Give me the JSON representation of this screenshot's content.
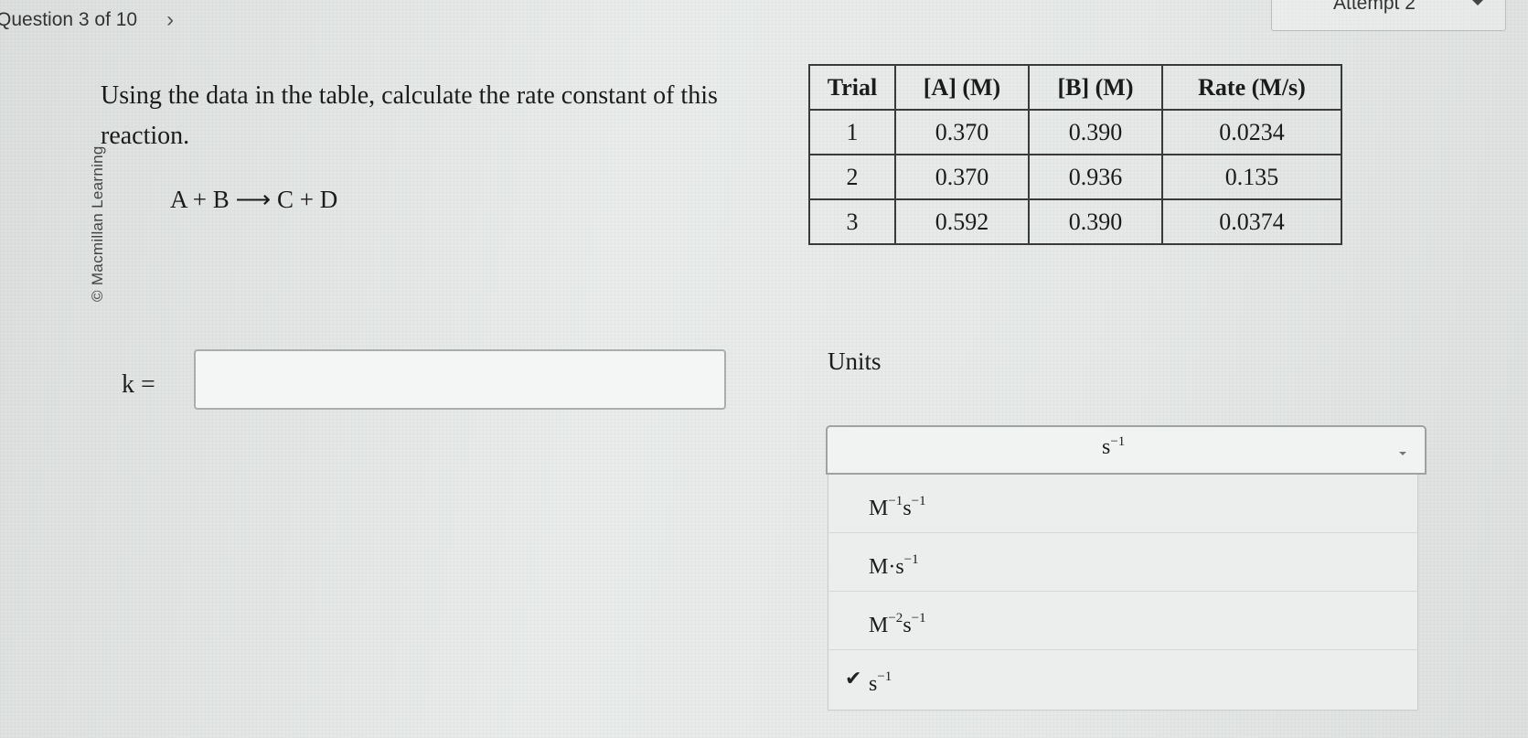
{
  "header": {
    "question_progress": "Question 3 of 10",
    "next_chevron": "›",
    "attempt_label": "Attempt 2"
  },
  "copyright": "© Macmillan Learning",
  "question": {
    "prompt": "Using the data in the table, calculate the rate constant of this reaction.",
    "reaction": "A + B ⟶ C + D"
  },
  "table": {
    "headers": [
      "Trial",
      "[A] (M)",
      "[B] (M)",
      "Rate (M/s)"
    ],
    "rows": [
      [
        "1",
        "0.370",
        "0.390",
        "0.0234"
      ],
      [
        "2",
        "0.370",
        "0.936",
        "0.135"
      ],
      [
        "3",
        "0.592",
        "0.390",
        "0.0374"
      ]
    ]
  },
  "answer": {
    "k_label": "k =",
    "k_value": "",
    "units_label": "Units",
    "units_selected": {
      "base": "s",
      "exp": "−1"
    },
    "units_options": [
      {
        "text": "M⁻¹s⁻¹",
        "parts": [
          [
            "M",
            "−1"
          ],
          [
            "s",
            "−1"
          ]
        ],
        "checked": false
      },
      {
        "text": "M·s⁻¹",
        "parts": [
          [
            "M·s",
            "−1"
          ]
        ],
        "checked": false
      },
      {
        "text": "M⁻²s⁻¹",
        "parts": [
          [
            "M",
            "−2"
          ],
          [
            "s",
            "−1"
          ]
        ],
        "checked": false
      },
      {
        "text": "s⁻¹",
        "parts": [
          [
            "s",
            "−1"
          ]
        ],
        "checked": true
      }
    ],
    "check_icon": "check-icon"
  }
}
